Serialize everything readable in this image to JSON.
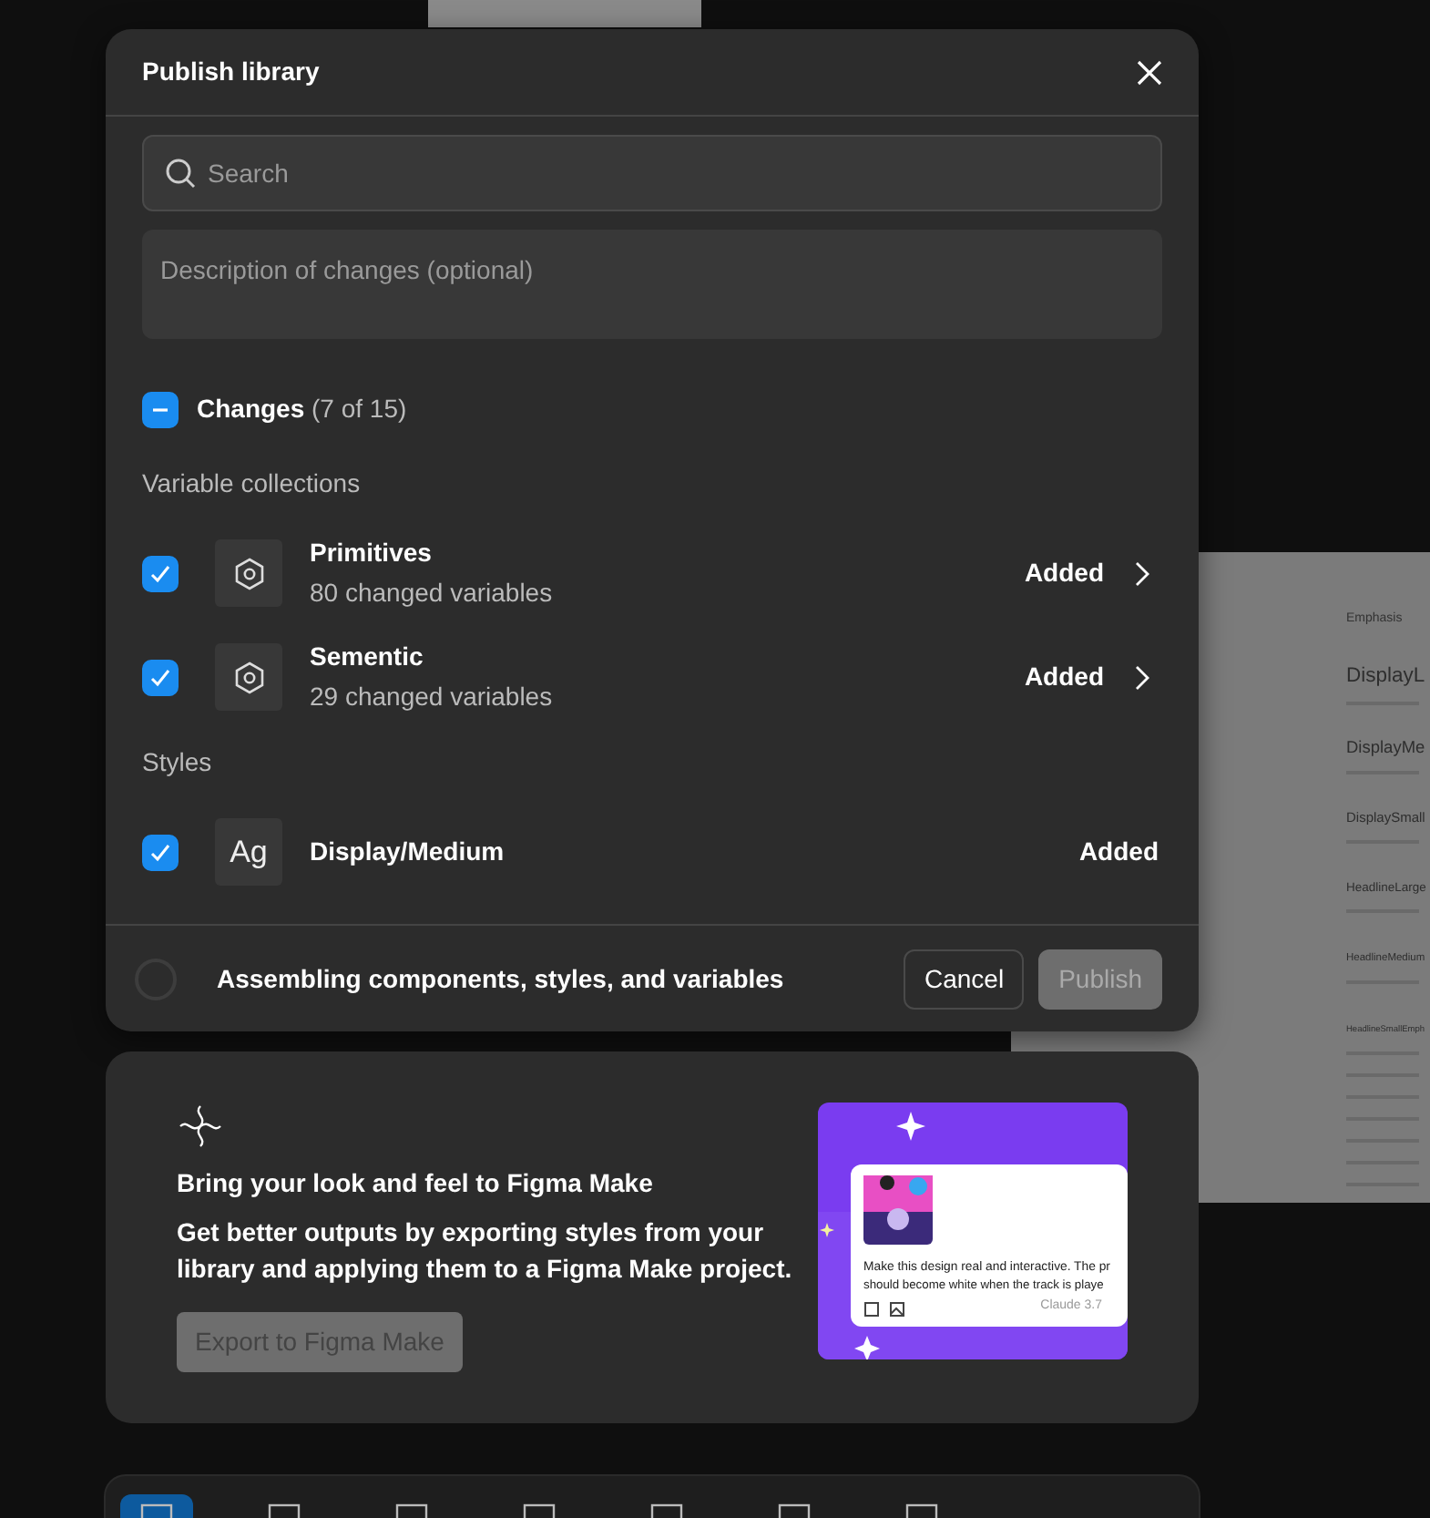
{
  "canvas_frame": {
    "heading": "Emphasis",
    "styles": [
      "DisplayL",
      "DisplayMe",
      "DisplaySmall",
      "HeadlineLarge",
      "HeadlineMedium",
      "HeadlineSmallEmph"
    ]
  },
  "dialog": {
    "title": "Publish library",
    "search": {
      "placeholder": "Search"
    },
    "description": {
      "placeholder": "Description of changes (optional)"
    },
    "changes": {
      "label": "Changes",
      "count": "(7 of 15)",
      "checked": true,
      "indeterminate": true
    },
    "sections": [
      {
        "title": "Variable collections",
        "items": [
          {
            "kind": "collection",
            "name": "Primitives",
            "detail": "80 changed variables",
            "status": "Added",
            "checked": true,
            "expandable": true
          },
          {
            "kind": "collection",
            "name": "Sementic",
            "detail": "29 changed variables",
            "status": "Added",
            "checked": true,
            "expandable": true
          }
        ]
      },
      {
        "title": "Styles",
        "items": [
          {
            "kind": "style",
            "icon_text": "Ag",
            "name": "Display/Medium",
            "status": "Added",
            "checked": true,
            "expandable": false
          }
        ]
      }
    ],
    "footer": {
      "status": "Assembling components, styles, and variables",
      "buttons": [
        {
          "label": "Cancel",
          "disabled": false
        },
        {
          "label": "Publish",
          "disabled": true
        }
      ]
    }
  },
  "promo": {
    "title": "Bring your look and feel to Figma Make",
    "text": "Get better outputs by exporting styles from your library and applying them to a Figma Make project.",
    "button": {
      "label": "Export to Figma Make",
      "disabled": true
    },
    "preview": {
      "prompt": "Make this design real and interactive. The pr",
      "prompt_line_2": "should become white when the track is playe",
      "model": "Claude 3.7"
    }
  },
  "toolbar": {
    "tools": [
      {
        "selected": true
      },
      {
        "selected": false
      },
      {
        "selected": false
      },
      {
        "selected": false
      },
      {
        "selected": false
      },
      {
        "selected": false
      },
      {
        "selected": false
      }
    ]
  }
}
